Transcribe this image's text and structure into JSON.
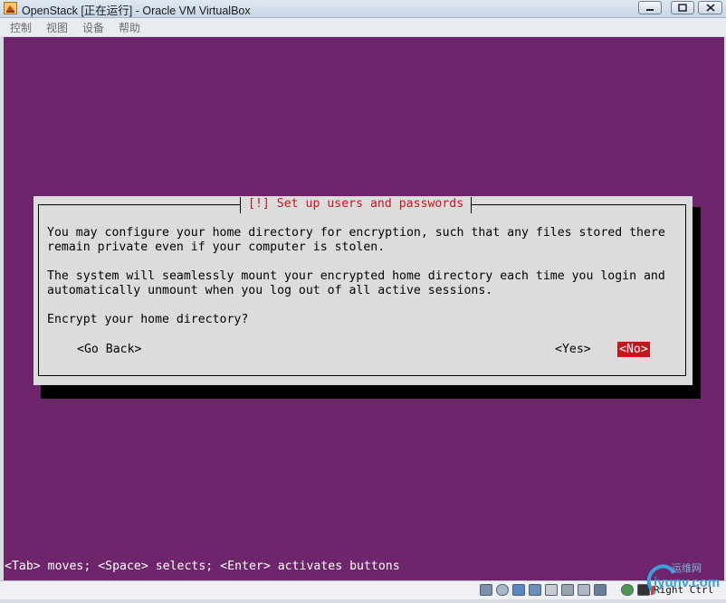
{
  "window": {
    "title": "OpenStack [正在运行] - Oracle VM VirtualBox",
    "controls": [
      "minimize",
      "maximize",
      "close"
    ]
  },
  "menu": [
    "控制",
    "视图",
    "设备",
    "帮助"
  ],
  "dialog": {
    "title": "[!] Set up users and passwords",
    "paragraph1": [
      "You may configure your home directory for encryption, such that any files stored there",
      "remain private even if your computer is stolen."
    ],
    "paragraph2": [
      "The system will seamlessly mount your encrypted home directory each time you login and",
      "automatically unmount when you log out of all active sessions."
    ],
    "question": "Encrypt your home directory?",
    "buttons": {
      "go_back": "<Go Back>",
      "yes": "<Yes>",
      "no": "<No>"
    },
    "selected_button": "no"
  },
  "hint": "<Tab> moves; <Space> selects; <Enter> activates buttons",
  "statusbar": {
    "host_key": "Right Ctrl"
  },
  "watermark": {
    "line1": "运维网",
    "line2": "iyunv.com"
  },
  "colors": {
    "screen_bg": "#6f256c",
    "dialog_bg": "#dcdcdc",
    "accent_red": "#c4161c"
  }
}
